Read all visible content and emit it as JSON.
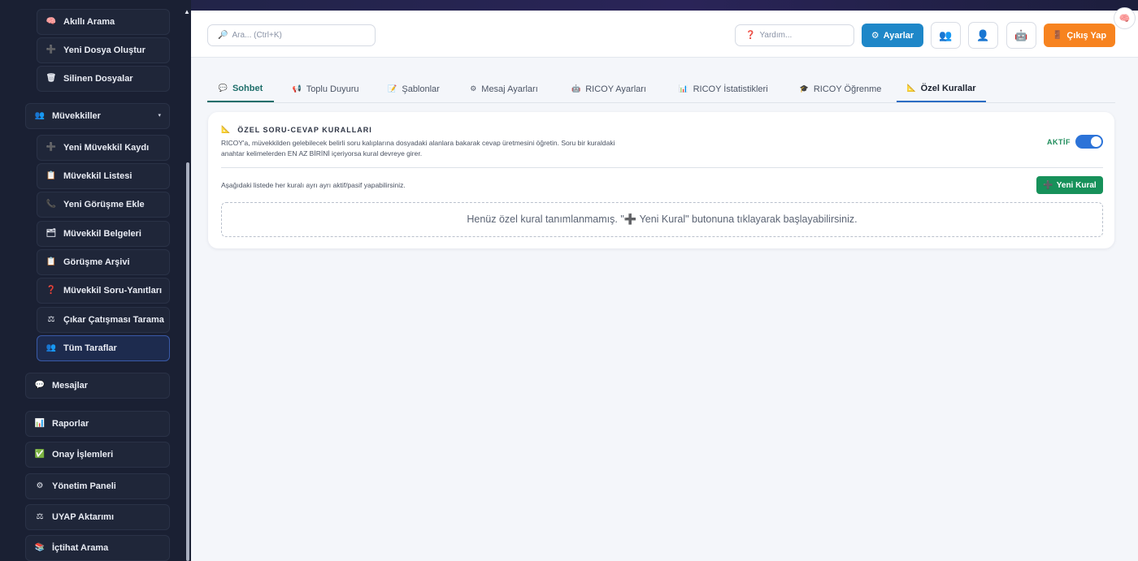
{
  "sidebar": {
    "items": [
      {
        "label": "Akıllı Arama",
        "icon": "brain-icon",
        "glyph": "🧠"
      },
      {
        "label": "Yeni Dosya Oluştur",
        "icon": "plus-icon",
        "glyph": "➕"
      },
      {
        "label": "Silinen Dosyalar",
        "icon": "trash-icon",
        "glyph": "🗑"
      },
      {
        "label": "Müvekkiller",
        "icon": "people-icon",
        "glyph": "👥",
        "caret": "▾"
      },
      {
        "label": "Yeni Müvekkil Kaydı",
        "icon": "plus-icon",
        "glyph": "➕"
      },
      {
        "label": "Müvekkil Listesi",
        "icon": "clipboard-icon",
        "glyph": "📋"
      },
      {
        "label": "Yeni Görüşme Ekle",
        "icon": "phone-icon",
        "glyph": "📞"
      },
      {
        "label": "Müvekkil Belgeleri",
        "icon": "folder-icon",
        "glyph": "🗂"
      },
      {
        "label": "Görüşme Arşivi",
        "icon": "clipboard-icon",
        "glyph": "📋"
      },
      {
        "label": "Müvekkil Soru-Yanıtları",
        "icon": "question-icon",
        "glyph": "❓"
      },
      {
        "label": "Çıkar Çatışması Tarama",
        "icon": "scale-icon",
        "glyph": "⚖"
      },
      {
        "label": "Tüm Taraflar",
        "icon": "group-icon",
        "glyph": "👥"
      },
      {
        "label": "Mesajlar",
        "icon": "speech-bubble-icon",
        "glyph": "💬"
      },
      {
        "label": "Raporlar",
        "icon": "bar-chart-icon",
        "glyph": "📊"
      },
      {
        "label": "Onay İşlemleri",
        "icon": "check-icon",
        "glyph": "✅"
      },
      {
        "label": "Yönetim Paneli",
        "icon": "gear-icon",
        "glyph": "⚙"
      },
      {
        "label": "UYAP Aktarımı",
        "icon": "scale-icon",
        "glyph": "⚖"
      },
      {
        "label": "İçtihat Arama",
        "icon": "books-icon",
        "glyph": "📚"
      }
    ]
  },
  "topbar": {
    "search_placeholder": "Ara... (Ctrl+K)",
    "search_icon": "🔎",
    "help_placeholder": "Yardım...",
    "help_icon": "❓",
    "settings_label": "Ayarlar",
    "settings_icon": "⚙",
    "icon_buttons": [
      {
        "icon": "teams-icon",
        "glyph": "👥"
      },
      {
        "icon": "user-icon",
        "glyph": "👤"
      },
      {
        "icon": "robot-icon",
        "glyph": "🤖"
      }
    ],
    "logout_label": "Çıkış Yap",
    "logout_icon": "🚪",
    "corner_glyph": "🧠"
  },
  "tabs": [
    {
      "label": "Sohbet",
      "icon": "speech-bubble-icon",
      "glyph": "💬"
    },
    {
      "label": "Toplu Duyuru",
      "icon": "megaphone-icon",
      "glyph": "📢"
    },
    {
      "label": "Şablonlar",
      "icon": "memo-icon",
      "glyph": "📝"
    },
    {
      "label": "Mesaj Ayarları",
      "icon": "gear-icon",
      "glyph": "⚙"
    },
    {
      "label": "RICOY Ayarları",
      "icon": "robot-icon",
      "glyph": "🤖"
    },
    {
      "label": "RICOY İstatistikleri",
      "icon": "bar-chart-icon",
      "glyph": "📊"
    },
    {
      "label": "RICOY Öğrenme",
      "icon": "graduation-cap-icon",
      "glyph": "🎓"
    },
    {
      "label": "Özel Kurallar",
      "icon": "triangle-ruler-icon",
      "glyph": "📐"
    }
  ],
  "card": {
    "title": "ÖZEL SORU-CEVAP KURALLARI",
    "title_icon": "📐",
    "description": "RICOY'a, müvekkilden gelebilecek belirli soru kalıplarına dosyadaki alanlara bakarak cevap üretmesini öğretin. Soru bir kuraldaki anahtar kelimelerden EN AZ BİRİNİ içeriyorsa kural devreye girer.",
    "status_label": "AKTİF",
    "toggle_on": true,
    "hint": "Aşağıdaki listede her kuralı ayrı ayrı aktif/pasif yapabilirsiniz.",
    "new_rule_label": "Yeni Kural",
    "new_rule_icon": "➕",
    "empty_message": "Henüz özel kural tanımlanmamış. \"➕ Yeni Kural\" butonuna tıklayarak başlayabilirsiniz."
  },
  "colors": {
    "accent_blue": "#1e87c8",
    "logout_orange": "#f7831f",
    "success_green": "#17915a",
    "toggle_blue": "#2c73d8",
    "sidebar_bg": "#1a2033"
  }
}
